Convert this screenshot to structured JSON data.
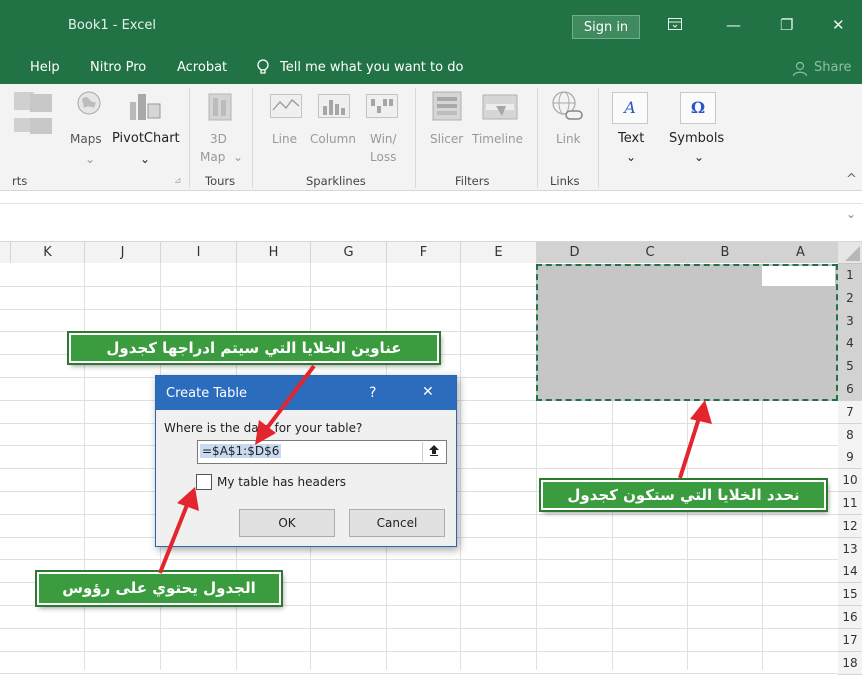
{
  "titlebar": {
    "title": "Book1  -  Excel",
    "signin": "Sign in",
    "ribbon_opts_icon": "ribbon-display-options-icon",
    "minimize_glyph": "—",
    "restore_glyph": "❐",
    "close_glyph": "✕"
  },
  "tabs": [
    "Help",
    "Nitro Pro",
    "Acrobat",
    "Tell me what you want to do",
    "Share"
  ],
  "ribbon": {
    "maps": "Maps",
    "pivotchart": "PivotChart",
    "map3d_1": "3D",
    "map3d_2": "Map",
    "line": "Line",
    "column": "Column",
    "winloss_1": "Win/",
    "winloss_2": "Loss",
    "slicer": "Slicer",
    "timeline": "Timeline",
    "link": "Link",
    "text": "Text",
    "symbols": "Symbols",
    "group_charts": "rts",
    "group_tours": "Tours",
    "group_sparklines": "Sparklines",
    "group_filters": "Filters",
    "group_links": "Links"
  },
  "grid": {
    "columns": [
      "K",
      "J",
      "I",
      "H",
      "G",
      "F",
      "E",
      "D",
      "C",
      "B",
      "A"
    ],
    "rows": [
      "1",
      "2",
      "3",
      "4",
      "5",
      "6",
      "7",
      "8",
      "9",
      "10",
      "11",
      "12",
      "13",
      "14",
      "15",
      "16",
      "17",
      "18"
    ],
    "selection": "A1:D6"
  },
  "dialog": {
    "title": "Create Table",
    "help": "?",
    "close": "✕",
    "prompt": "Where is the data for your table?",
    "range": "=$A$1:$D$6",
    "checkbox_label": "My table has headers",
    "checked": false,
    "ok": "OK",
    "cancel": "Cancel"
  },
  "callouts": {
    "top": "عناوين الخلايا التي سيتم ادراجها كجدول",
    "right": "نحدد الخلايا التي ستكون كجدول",
    "bottom": "الجدول يحتوي على رؤوس"
  },
  "colors": {
    "excel_green": "#217346",
    "dialog_blue": "#2b6cbd",
    "callout_green": "#3a9c3f",
    "arrow_red": "#e3262d"
  }
}
